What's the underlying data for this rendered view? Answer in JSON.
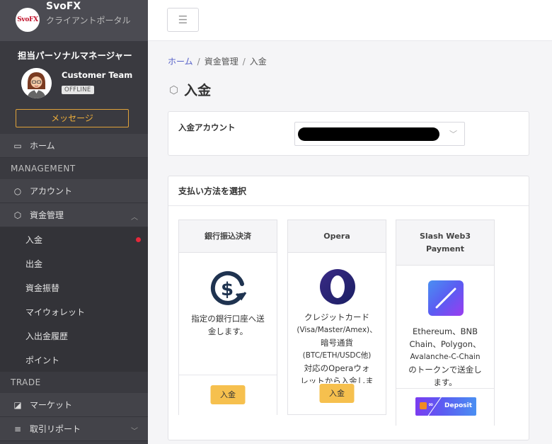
{
  "brand": {
    "logo_text": "SvoFX",
    "name": "SvoFX",
    "subtitle": "クライアントポータル"
  },
  "manager": {
    "title": "担当パーソナルマネージャー",
    "name": "Customer Team",
    "status": "OFFLINE",
    "message_button": "メッセージ"
  },
  "nav": {
    "home": "ホーム",
    "section_management": "MANAGEMENT",
    "account": "アカウント",
    "funds": "資金管理",
    "funds_sub": [
      "入金",
      "出金",
      "資金振替",
      "マイウォレット",
      "入出金履歴",
      "ポイント"
    ],
    "section_trade": "TRADE",
    "market": "マーケット",
    "report": "取引リポート"
  },
  "breadcrumb": {
    "home": "ホーム",
    "funds": "資金管理",
    "current": "入金",
    "sep": "/"
  },
  "page": {
    "title": "入金"
  },
  "account_select": {
    "label": "入金アカウント"
  },
  "payment": {
    "heading": "支払い方法を選択",
    "methods": [
      {
        "title": "銀行振込決済",
        "desc_lines": [
          "指定の銀行口座へ送",
          "金します。"
        ],
        "button": "入金"
      },
      {
        "title": "Opera",
        "desc_lines": [
          "クレジットカード",
          "(Visa/Master/Amex)、",
          "暗号通貨",
          "(BTC/ETH/USDC他)",
          "対応のOperaウォ",
          "レットから入金しま"
        ],
        "button": "入金"
      },
      {
        "title_lines": [
          "Slash Web3",
          "Payment"
        ],
        "desc_lines": [
          "Ethereum、BNB",
          "Chain、Polygon、",
          "Avalanche-C-Chain",
          "のトークンで送金し",
          "ます。"
        ],
        "button": "Deposit"
      }
    ]
  },
  "colors": {
    "accent": "#5560c8",
    "button": "#f6c04e",
    "sidebar": "#3f3f45",
    "alert": "#e5283a"
  }
}
